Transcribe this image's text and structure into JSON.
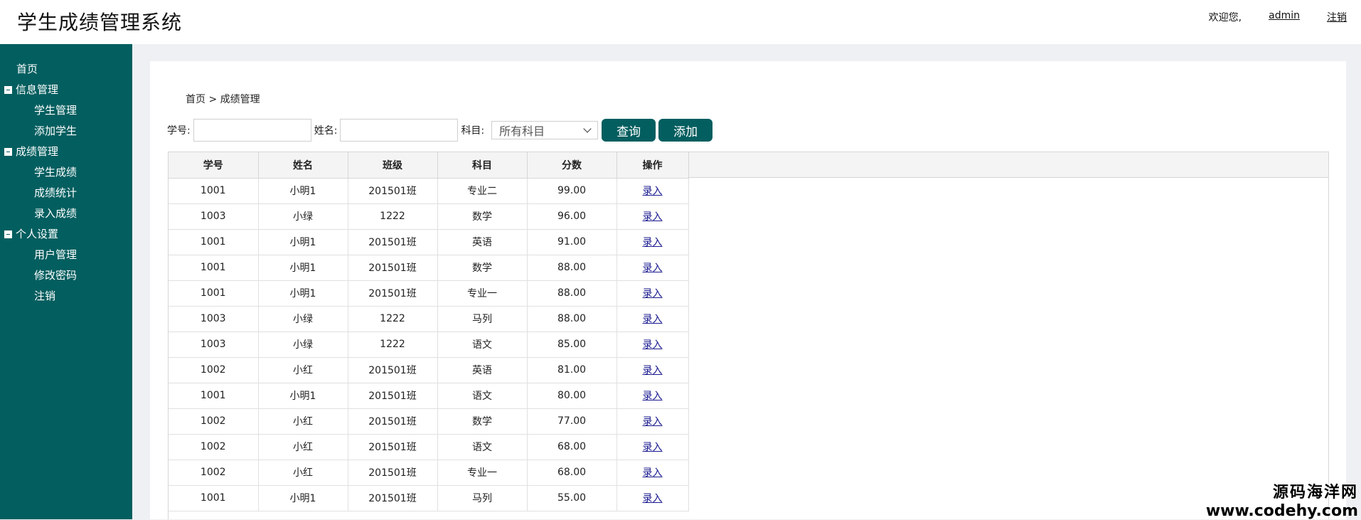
{
  "header": {
    "title": "学生成绩管理系统",
    "welcome": "欢迎您,",
    "username": "admin",
    "logout": "注销"
  },
  "sidebar": {
    "home": "首页",
    "groups": [
      {
        "label": "信息管理",
        "items": [
          "学生管理",
          "添加学生"
        ]
      },
      {
        "label": "成绩管理",
        "items": [
          "学生成绩",
          "成绩统计",
          "录入成绩"
        ]
      },
      {
        "label": "个人设置",
        "items": [
          "用户管理",
          "修改密码",
          "注销"
        ]
      }
    ]
  },
  "breadcrumb": "首页 > 成绩管理",
  "search": {
    "student_id_label": "学号:",
    "student_id_value": "",
    "name_label": "姓名:",
    "name_value": "",
    "subject_label": "科目:",
    "subject_selected": "所有科目",
    "query_button": "查询",
    "add_button": "添加"
  },
  "table": {
    "columns": [
      "学号",
      "姓名",
      "班级",
      "科目",
      "分数",
      "操作"
    ],
    "rows": [
      [
        "1001",
        "小明1",
        "201501班",
        "专业二",
        "99.00",
        "录入"
      ],
      [
        "1003",
        "小绿",
        "1222",
        "数学",
        "96.00",
        "录入"
      ],
      [
        "1001",
        "小明1",
        "201501班",
        "英语",
        "91.00",
        "录入"
      ],
      [
        "1001",
        "小明1",
        "201501班",
        "数学",
        "88.00",
        "录入"
      ],
      [
        "1001",
        "小明1",
        "201501班",
        "专业一",
        "88.00",
        "录入"
      ],
      [
        "1003",
        "小绿",
        "1222",
        "马列",
        "88.00",
        "录入"
      ],
      [
        "1003",
        "小绿",
        "1222",
        "语文",
        "85.00",
        "录入"
      ],
      [
        "1002",
        "小红",
        "201501班",
        "英语",
        "81.00",
        "录入"
      ],
      [
        "1001",
        "小明1",
        "201501班",
        "语文",
        "80.00",
        "录入"
      ],
      [
        "1002",
        "小红",
        "201501班",
        "数学",
        "77.00",
        "录入"
      ],
      [
        "1002",
        "小红",
        "201501班",
        "语文",
        "68.00",
        "录入"
      ],
      [
        "1002",
        "小红",
        "201501班",
        "专业一",
        "68.00",
        "录入"
      ],
      [
        "1001",
        "小明1",
        "201501班",
        "马列",
        "55.00",
        "录入"
      ]
    ]
  },
  "watermark": {
    "line1": "源码海洋网",
    "line2": "www.codehy.com"
  },
  "colors": {
    "primary": "#035e5f"
  }
}
